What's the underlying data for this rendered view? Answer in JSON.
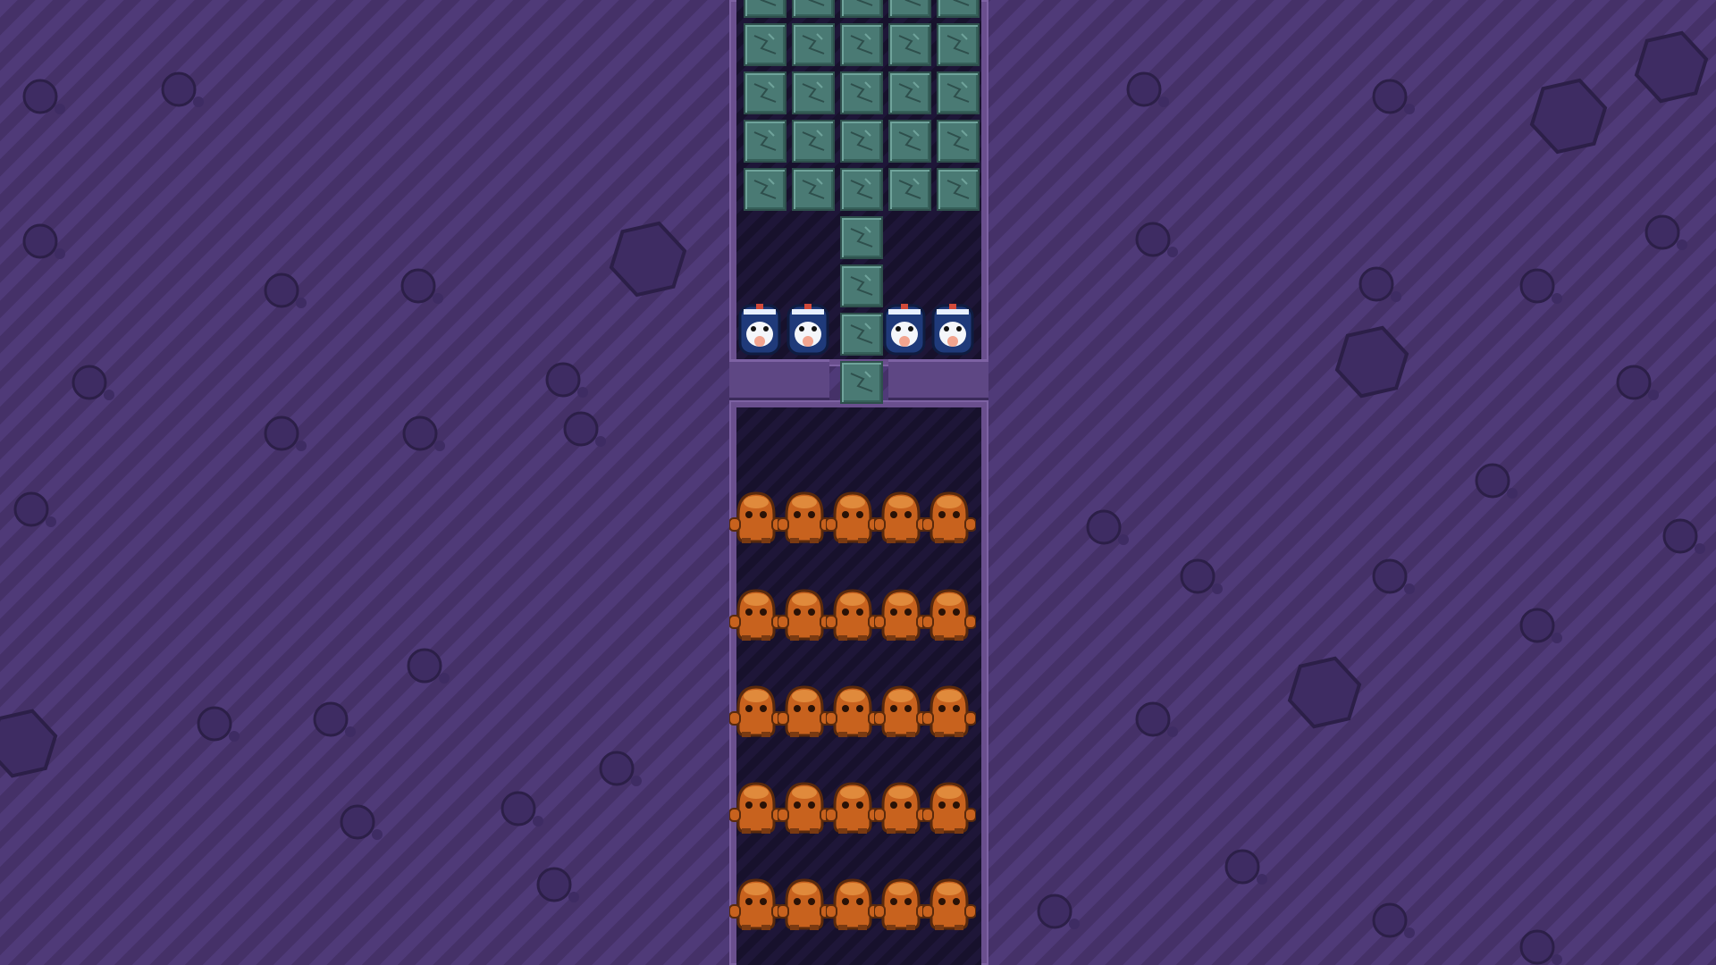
{
  "scene": {
    "title": "",
    "entities": {
      "stone_blocks": 29,
      "penguin_bots": 4,
      "orange_creatures": 25
    },
    "colors": {
      "background": "#4f3a78",
      "background_stripe": "#453168",
      "pit": "#1e1638",
      "block": "#4a7a74",
      "creature": "#c8621e",
      "penguin_body": "#1f3a7a"
    },
    "icons": {
      "block": "stone-block-icon",
      "penguin": "penguin-bot-icon",
      "creature": "orange-creature-icon",
      "rock": "hexagon-rock-icon"
    }
  }
}
